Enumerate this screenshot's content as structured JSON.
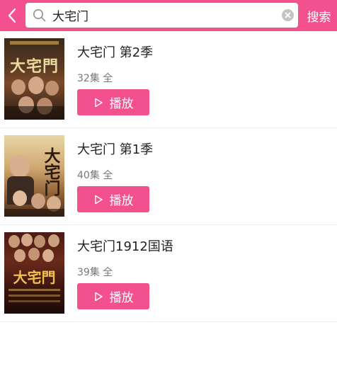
{
  "search": {
    "value": "大宅门",
    "placeholder": "",
    "button_label": "搜索"
  },
  "results": [
    {
      "title": "大宅门 第2季",
      "meta": "32集 全",
      "play_label": "播放",
      "poster_text": "大宅門"
    },
    {
      "title": "大宅门 第1季",
      "meta": "40集 全",
      "play_label": "播放",
      "poster_text": "大宅门"
    },
    {
      "title": "大宅门1912国语",
      "meta": "39集 全",
      "play_label": "播放",
      "poster_text": "大宅門"
    }
  ],
  "colors": {
    "accent": "#f2518e",
    "divider": "#ececec"
  }
}
